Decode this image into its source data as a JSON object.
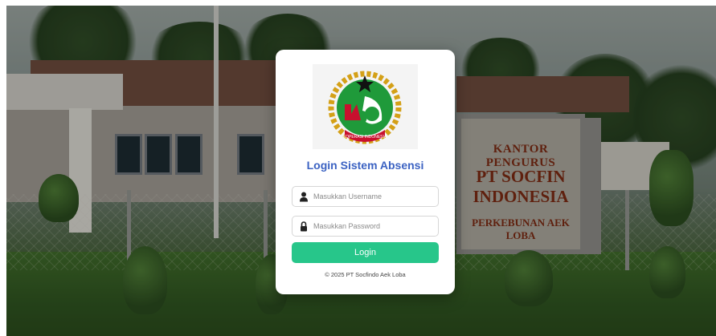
{
  "background": {
    "sign": {
      "line1": "KANTOR PENGURUS",
      "line2": "PT SOCFIN",
      "line3": "INDONESIA",
      "line4": "PERKEBUNAN AEK LOBA"
    }
  },
  "login": {
    "logo_icon": "koperasi-indonesia-logo",
    "title": "Login Sistem Absensi",
    "username": {
      "icon": "user-icon",
      "placeholder": "Masukkan Username",
      "value": ""
    },
    "password": {
      "icon": "lock-icon",
      "placeholder": "Masukkan Password",
      "value": ""
    },
    "button_label": "Login",
    "footer": "© 2025 PT Socfindo Aek Loba"
  },
  "colors": {
    "title": "#3b62c2",
    "button": "#27c68a",
    "logo_green": "#1f9a3a",
    "logo_red": "#c8102e",
    "logo_gold": "#d4a017"
  }
}
